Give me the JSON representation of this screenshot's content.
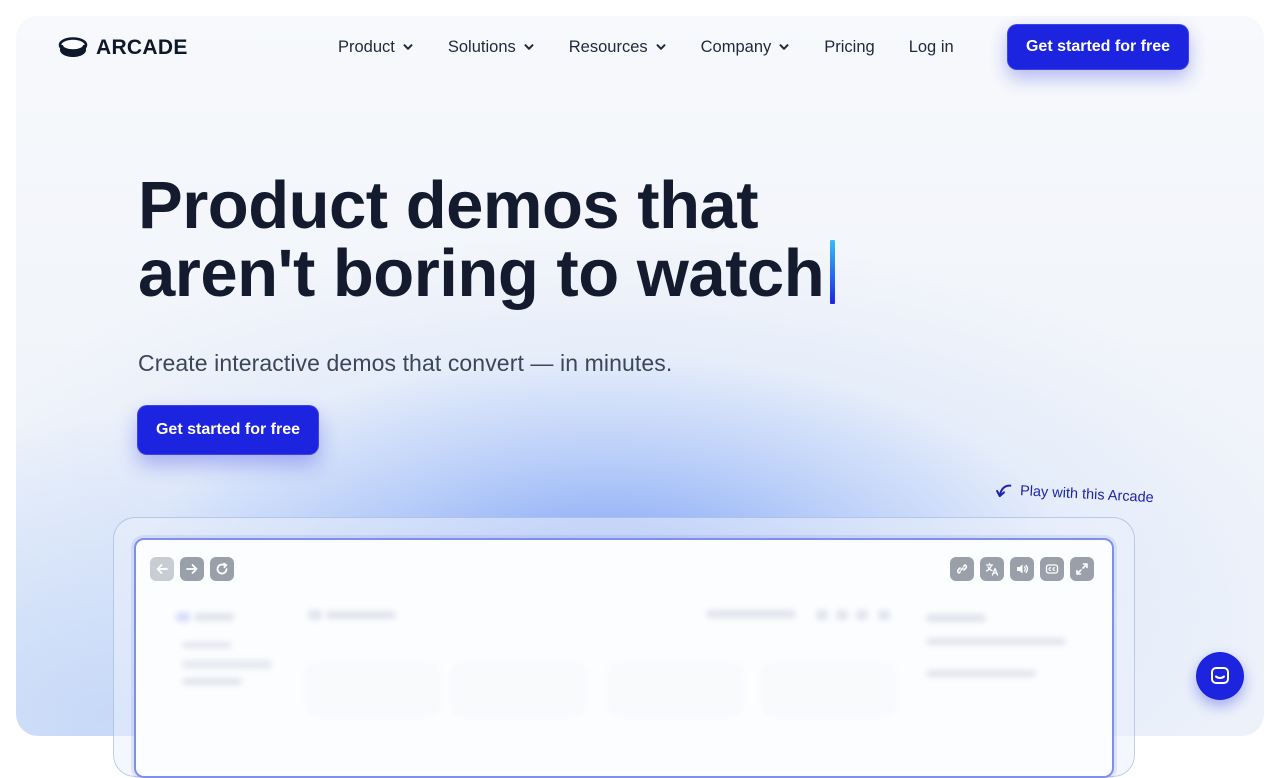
{
  "brand": {
    "name": "ARCADE"
  },
  "nav": {
    "items": [
      {
        "label": "Product",
        "has_dropdown": true
      },
      {
        "label": "Solutions",
        "has_dropdown": true
      },
      {
        "label": "Resources",
        "has_dropdown": true
      },
      {
        "label": "Company",
        "has_dropdown": true
      },
      {
        "label": "Pricing",
        "has_dropdown": false
      },
      {
        "label": "Log in",
        "has_dropdown": false
      }
    ],
    "cta_label": "Get started for free"
  },
  "hero": {
    "title_line1": "Product demos that",
    "title_line2": "aren't boring to watch",
    "subtitle": "Create interactive demos that convert — in minutes.",
    "cta_label": "Get started for free"
  },
  "demo": {
    "note": "Play with this Arcade",
    "left_controls": [
      "back-icon",
      "forward-icon",
      "refresh-icon"
    ],
    "right_controls": [
      "link-icon",
      "translate-icon",
      "sound-icon",
      "captions-icon",
      "fullscreen-icon"
    ]
  },
  "colors": {
    "accent": "#1d24e0",
    "text_primary": "#141b2e",
    "text_secondary": "#3b4658",
    "control_gray": "#9aa0aa"
  },
  "icons": {
    "chat": "chat-bubble-icon",
    "logo": "arcade-logo-icon"
  }
}
